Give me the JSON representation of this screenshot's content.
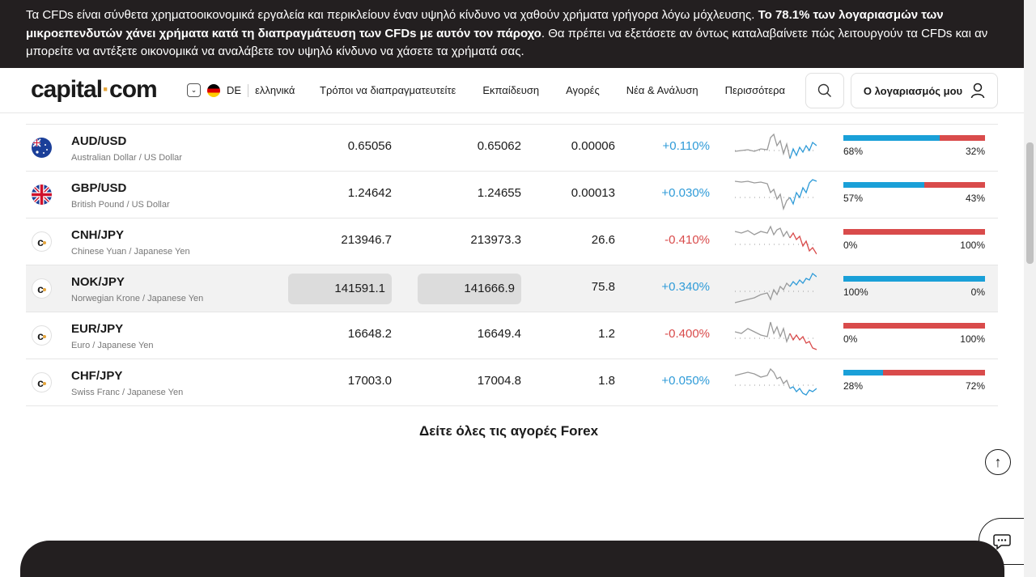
{
  "risk_banner": {
    "part1": "Τα CFDs είναι σύνθετα χρηματοοικονομικά εργαλεία και περικλείουν έναν υψηλό κίνδυνο να χαθούν χρήματα γρήγορα λόγω μόχλευσης.",
    "bold": "Το 78.1% των λογαριασμών των μικροεπενδυτών χάνει χρήματα κατά τη διαπραγμάτευση των CFDs με αυτόν τον πάροχο",
    "part2": ". Θα πρέπει να εξετάσετε αν όντως καταλαβαίνετε πώς λειτουργούν τα CFDs και αν μπορείτε να αντέξετε οικονομικά να αναλάβετε τον υψηλό κίνδυνο να χάσετε τα χρήματά σας."
  },
  "header": {
    "logo_main": "capital",
    "logo_dot": "·",
    "logo_tld": "com",
    "region_code": "DE",
    "language": "ελληνικά",
    "nav": [
      "Τρόποι να διαπραγματευτείτε",
      "Εκπαίδευση",
      "Αγορές",
      "Νέα & Ανάλυση",
      "Περισσότερα"
    ],
    "account_label": "Ο λογαριασμός μου"
  },
  "markets": {
    "rows": [
      {
        "symbol": "AUD/USD",
        "name": "Australian Dollar / US Dollar",
        "sell": "0.65056",
        "buy": "0.65062",
        "spread": "0.00006",
        "change": "+0.110%",
        "dir": "pos",
        "buyers": 68,
        "sellers": 32,
        "buyers_label": "68%",
        "sellers_label": "32%"
      },
      {
        "symbol": "GBP/USD",
        "name": "British Pound / US Dollar",
        "sell": "1.24642",
        "buy": "1.24655",
        "spread": "0.00013",
        "change": "+0.030%",
        "dir": "pos",
        "buyers": 57,
        "sellers": 43,
        "buyers_label": "57%",
        "sellers_label": "43%"
      },
      {
        "symbol": "CNH/JPY",
        "name": "Chinese Yuan / Japanese Yen",
        "sell": "213946.7",
        "buy": "213973.3",
        "spread": "26.6",
        "change": "-0.410%",
        "dir": "neg",
        "buyers": 0,
        "sellers": 100,
        "buyers_label": "0%",
        "sellers_label": "100%"
      },
      {
        "symbol": "NOK/JPY",
        "name": "Norwegian Krone / Japanese Yen",
        "sell": "141591.1",
        "buy": "141666.9",
        "spread": "75.8",
        "change": "+0.340%",
        "dir": "pos",
        "buyers": 100,
        "sellers": 0,
        "buyers_label": "100%",
        "sellers_label": "0%"
      },
      {
        "symbol": "EUR/JPY",
        "name": "Euro / Japanese Yen",
        "sell": "16648.2",
        "buy": "16649.4",
        "spread": "1.2",
        "change": "-0.400%",
        "dir": "neg",
        "buyers": 0,
        "sellers": 100,
        "buyers_label": "0%",
        "sellers_label": "100%"
      },
      {
        "symbol": "CHF/JPY",
        "name": "Swiss Franc / Japanese Yen",
        "sell": "17003.0",
        "buy": "17004.8",
        "spread": "1.8",
        "change": "+0.050%",
        "dir": "pos",
        "buyers": 28,
        "sellers": 72,
        "buyers_label": "28%",
        "sellers_label": "72%"
      }
    ]
  },
  "see_all_label": "Δείτε όλες τις αγορές Forex",
  "colors": {
    "positive": "#2f9bd8",
    "negative": "#d94b4b",
    "dark": "#231f20",
    "accent": "#e5a53a"
  }
}
